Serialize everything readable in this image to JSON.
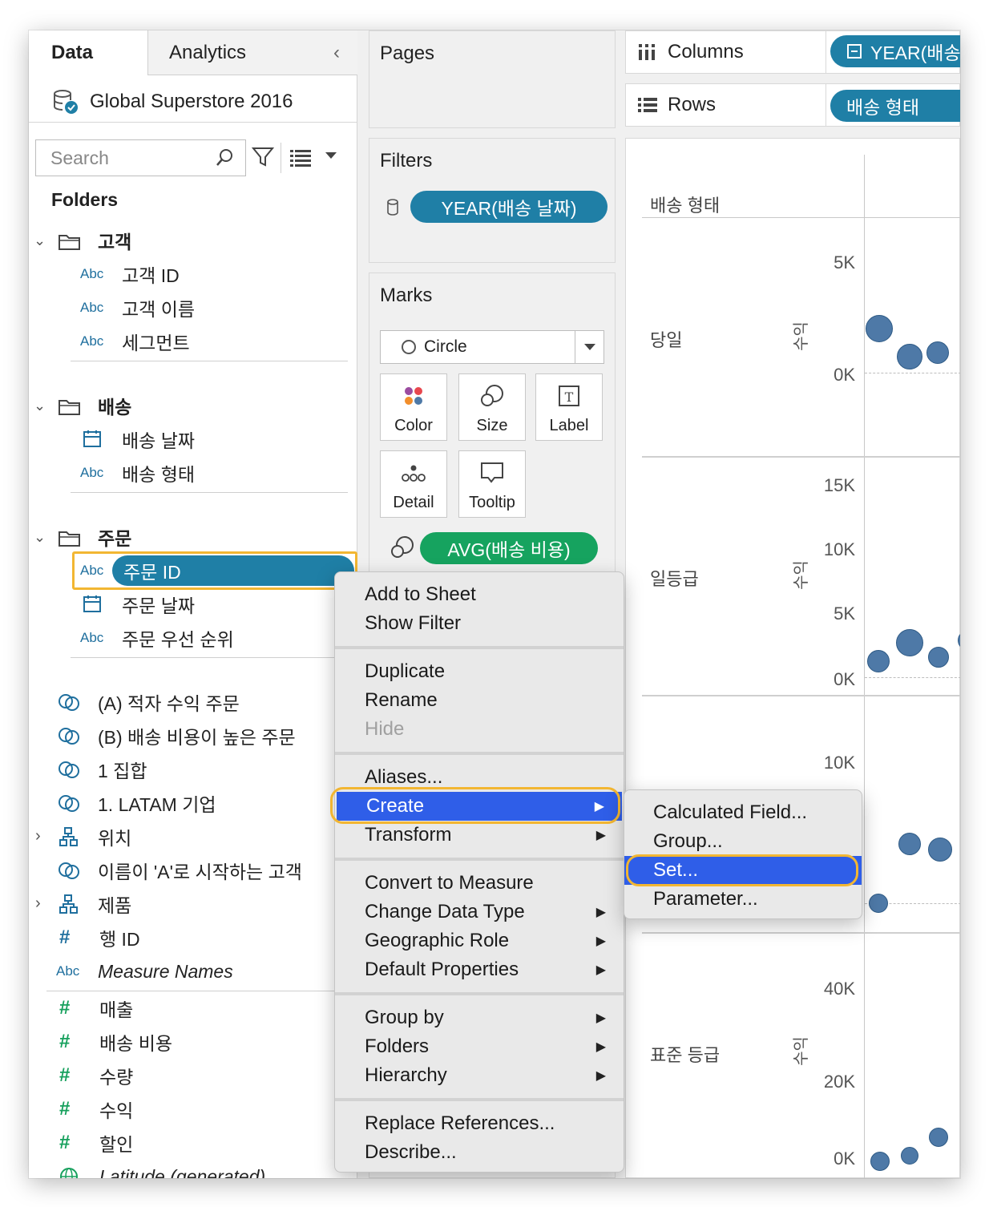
{
  "tabs": {
    "data": "Data",
    "analytics": "Analytics"
  },
  "datasource": "Global Superstore 2016",
  "search": {
    "placeholder": "Search"
  },
  "folders_title": "Folders",
  "groups": [
    {
      "name": "고객",
      "fields": [
        {
          "type": "Abc",
          "name": "고객 ID"
        },
        {
          "type": "Abc",
          "name": "고객 이름"
        },
        {
          "type": "Abc",
          "name": "세그먼트"
        }
      ]
    },
    {
      "name": "배송",
      "fields": [
        {
          "type": "date",
          "name": "배송 날짜"
        },
        {
          "type": "Abc",
          "name": "배송 형태"
        }
      ]
    },
    {
      "name": "주문",
      "fields": [
        {
          "type": "Abc",
          "name": "주문 ID"
        },
        {
          "type": "date",
          "name": "주문 날짜"
        },
        {
          "type": "Abc",
          "name": "주문 우선 순위"
        }
      ]
    }
  ],
  "other_fields": [
    {
      "type": "set",
      "name": "(A) 적자 수익 주문"
    },
    {
      "type": "set",
      "name": "(B) 배송 비용이 높은 주문"
    },
    {
      "type": "set",
      "name": "1 집합"
    },
    {
      "type": "set",
      "name": "1. LATAM 기업"
    },
    {
      "type": "hierarchy",
      "name": "위치"
    },
    {
      "type": "set",
      "name": "이름이 'A'로 시작하는 고객"
    },
    {
      "type": "hierarchy",
      "name": "제품"
    },
    {
      "type": "#",
      "name": "행 ID"
    },
    {
      "type": "Abc",
      "name": "Measure Names"
    }
  ],
  "measures": [
    {
      "type": "#",
      "name": "매출"
    },
    {
      "type": "#",
      "name": "배송 비용"
    },
    {
      "type": "#",
      "name": "수량"
    },
    {
      "type": "#",
      "name": "수익"
    },
    {
      "type": "#",
      "name": "할인"
    },
    {
      "type": "geo",
      "name": "Latitude (generated)"
    }
  ],
  "pages": {
    "title": "Pages"
  },
  "filters": {
    "title": "Filters",
    "pill": "YEAR(배송 날짜)"
  },
  "marks": {
    "title": "Marks",
    "type": "Circle",
    "buttons": [
      "Color",
      "Size",
      "Label",
      "Detail",
      "Tooltip"
    ],
    "size_pill": "AVG(배송 비용)"
  },
  "columns": {
    "label": "Columns",
    "pill": "YEAR(배송"
  },
  "rows": {
    "label": "Rows",
    "pill": "배송 형태"
  },
  "view": {
    "header": "배송 형태",
    "measure_label": "수익",
    "panes": [
      {
        "category": "당일",
        "ticks": [
          "5K",
          "0K"
        ]
      },
      {
        "category": "일등급",
        "ticks": [
          "15K",
          "10K",
          "5K",
          "0K"
        ]
      },
      {
        "category": "",
        "ticks": [
          "10K"
        ]
      },
      {
        "category": "표준 등급",
        "ticks": [
          "40K",
          "20K",
          "0K"
        ]
      }
    ]
  },
  "context_menu": {
    "items": [
      "Add to Sheet",
      "Show Filter",
      "Duplicate",
      "Rename",
      "Hide",
      "Aliases...",
      "Create",
      "Transform",
      "Convert to Measure",
      "Change Data Type",
      "Geographic Role",
      "Default Properties",
      "Group by",
      "Folders",
      "Hierarchy",
      "Replace References...",
      "Describe..."
    ]
  },
  "submenu": {
    "items": [
      "Calculated Field...",
      "Group...",
      "Set...",
      "Parameter..."
    ]
  },
  "colors": {
    "accent_pill": "#1f7fa6",
    "measure_pill": "#16a35f",
    "highlight": "#f2b632",
    "menu_active": "#2f5ee8",
    "mark": "#4e79a7"
  }
}
